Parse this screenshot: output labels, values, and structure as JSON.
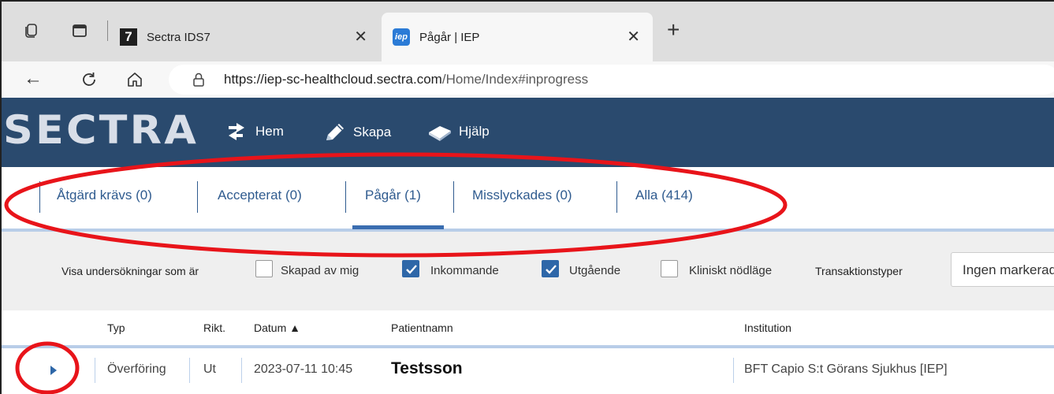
{
  "browser": {
    "tabs": [
      {
        "label": "Sectra IDS7",
        "favicon": "7",
        "active": false
      },
      {
        "label": "Pågår | IEP",
        "favicon": "iep",
        "active": true
      }
    ],
    "new_tab_icon": "plus-icon",
    "url_host": "https://iep-sc-healthcloud.sectra.com",
    "url_path": "/Home/Index#inprogress"
  },
  "app": {
    "logo_text": "SECTRA",
    "header_color": "#2a4a6e",
    "nav": [
      {
        "label": "Hem",
        "icon": "arrows-swap-icon"
      },
      {
        "label": "Skapa",
        "icon": "pencil-icon"
      },
      {
        "label": "Hjälp",
        "icon": "book-icon"
      }
    ]
  },
  "subtabs": [
    {
      "label": "Åtgärd krävs (0)",
      "active": false
    },
    {
      "label": "Accepterat (0)",
      "active": false
    },
    {
      "label": "Pågår (1)",
      "active": true
    },
    {
      "label": "Misslyckades (0)",
      "active": false
    },
    {
      "label": "Alla (414)",
      "active": false
    }
  ],
  "filter": {
    "label": "Visa undersökningar som är",
    "checkboxes": [
      {
        "label": "Skapad av mig",
        "checked": false
      },
      {
        "label": "Inkommande",
        "checked": true
      },
      {
        "label": "Utgående",
        "checked": true
      },
      {
        "label": "Kliniskt nödläge",
        "checked": false
      }
    ],
    "transaction_label": "Transaktionstyper",
    "transaction_value": "Ingen markerad"
  },
  "table": {
    "columns": [
      "Typ",
      "Rikt.",
      "Datum ▲",
      "Patientnamn",
      "Institution"
    ],
    "rows": [
      {
        "typ": "Överföring",
        "rikt": "Ut",
        "datum": "2023-07-11 10:45",
        "patient": "Testsson",
        "institution": "BFT Capio S:t Görans Sjukhus [IEP]"
      }
    ]
  },
  "annotation_color": "#e8141a"
}
